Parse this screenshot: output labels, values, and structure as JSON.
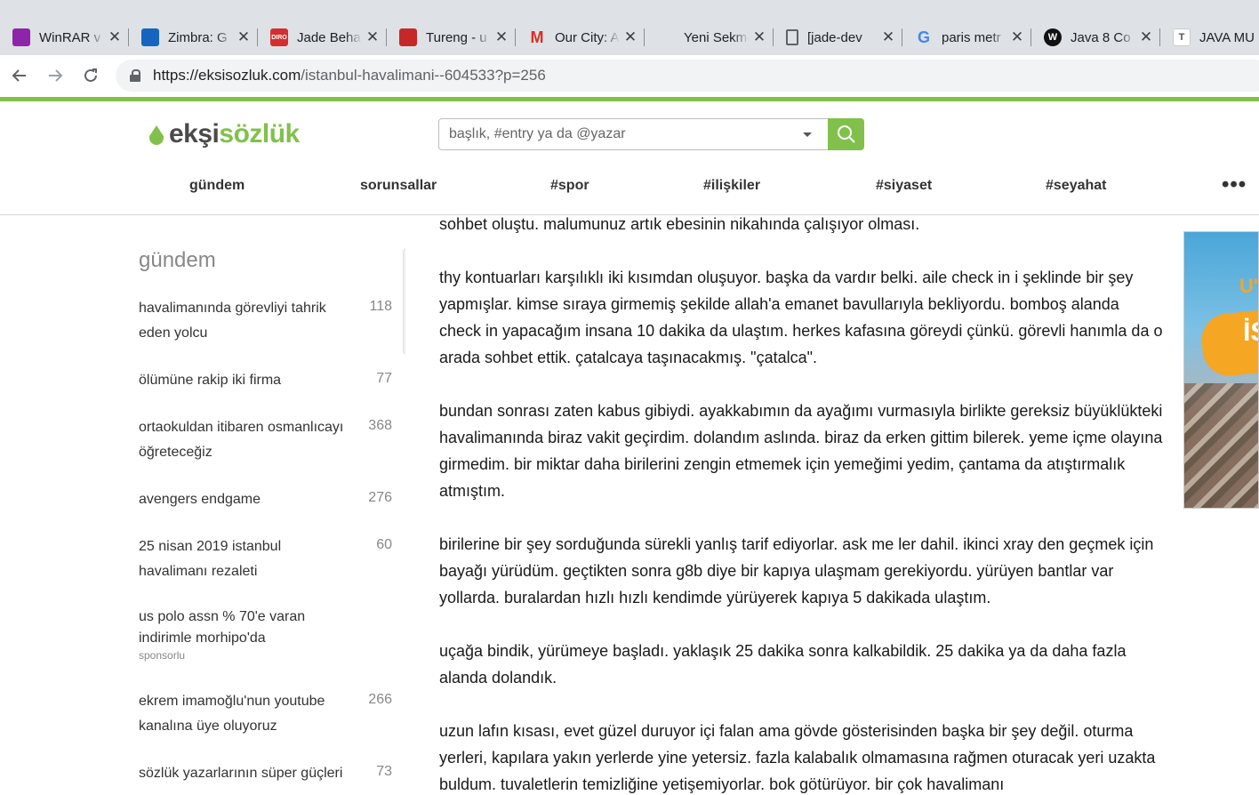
{
  "browser": {
    "tabs": [
      {
        "title": "WinRAR v",
        "icon": "winrar-icon",
        "color": "#8e24aa"
      },
      {
        "title": "Zimbra: G",
        "icon": "zimbra-icon",
        "color": "#1565c0"
      },
      {
        "title": "Jade Beha",
        "icon": "diro-icon",
        "color": "#d32f2f",
        "icon_text": "DIRO"
      },
      {
        "title": "Tureng - u",
        "icon": "tureng-icon",
        "color": "#c62828"
      },
      {
        "title": "Our City: A",
        "icon": "gmail-icon",
        "color": "#d93025"
      },
      {
        "title": "Yeni Sekme",
        "icon": "",
        "color": ""
      },
      {
        "title": "[jade-dev",
        "icon": "document-icon",
        "color": "#5f6368"
      },
      {
        "title": "paris metr",
        "icon": "google-icon",
        "color": "#4285f4"
      },
      {
        "title": "Java 8 Co",
        "icon": "w-icon",
        "color": "#111111"
      },
      {
        "title": "JAVA MU",
        "icon": "t-icon",
        "color": "#9e9e9e"
      }
    ],
    "url_host": "https://eksisozluk.com",
    "url_path": "/istanbul-havalimani--604533?p=256"
  },
  "site": {
    "logo_part1": "ekşi",
    "logo_part2": "sözlük",
    "accent": "#81c14b",
    "search_placeholder": "başlık, #entry ya da @yazar",
    "topics": [
      "gündem",
      "sorunsallar",
      "#spor",
      "#ilişkiler",
      "#siyaset",
      "#seyahat"
    ],
    "more": "•••"
  },
  "sidebar": {
    "title": "gündem",
    "items": [
      {
        "title": "havalimanında görevliyi tahrik eden yolcu",
        "count": "118"
      },
      {
        "title": "ölümüne rakip iki firma",
        "count": "77"
      },
      {
        "title": "ortaokuldan itibaren osmanlıcayı öğreteceğiz",
        "count": "368"
      },
      {
        "title": "avengers endgame",
        "count": "276"
      },
      {
        "title": "25 nisan 2019 istanbul havalimanı rezaleti",
        "count": "60"
      },
      {
        "title": "us polo assn % 70'e varan indirimle morhipo'da",
        "count": "",
        "sponsor": "sponsorlu"
      },
      {
        "title": "ekrem imamoğlu'nun youtube kanalına üye oluyoruz",
        "count": "266"
      },
      {
        "title": "sözlük yazarlarının süper güçleri",
        "count": "73"
      }
    ]
  },
  "entry": {
    "paragraphs": [
      "sohbet oluştu. malumunuz artık ebesinin nikahında çalışıyor olması.",
      "thy kontuarları karşılıklı iki kısımdan oluşuyor. başka da vardır belki. aile check in i şeklinde bir şey yapmışlar. kimse sıraya girmemiş şekilde allah'a emanet bavullarıyla bekliyordu. bomboş alanda check in yapacağım insana 10 dakika da ulaştım. herkes kafasına göreydi çünkü. görevli hanımla da o arada sohbet ettik. çatalcaya taşınacakmış. \"çatalca\".",
      "bundan sonrası zaten kabus gibiydi. ayakkabımın da ayağımı vurmasıyla birlikte gereksiz büyüklükteki havalimanında biraz vakit geçirdim. dolandım aslında. biraz da erken gittim bilerek. yeme içme olayına girmedim. bir miktar daha birilerini zengin etmemek için yemeğimi yedim, çantama da atıştırmalık atmıştım.",
      "birilerine bir şey sorduğunda sürekli yanlış tarif ediyorlar. ask me ler dahil. ikinci xray den geçmek için bayağı yürüdüm. geçtikten sonra g8b diye bir kapıya ulaşmam gerekiyordu. yürüyen bantlar var yollarda. buralardan hızlı hızlı kendimde yürüyerek kapıya 5 dakikada ulaştım.",
      "uçağa bindik, yürümeye başladı. yaklaşık 25 dakika sonra kalkabildik. 25 dakika ya da daha fazla alanda dolandık.",
      "uzun lafın kısası, evet güzel duruyor içi falan ama gövde gösterisinden başka bir şey değil. oturma yerleri, kapılara yakın yerlerde yine yetersiz. fazla kalabalık olmamasına rağmen oturacak yeri uzakta buldum. tuvaletlerin temizliğine yetişemiyorlar. bok götürüyor. bir çok havalimanı"
    ]
  },
  "ad": {
    "text1": "U'",
    "text2": "İS"
  }
}
